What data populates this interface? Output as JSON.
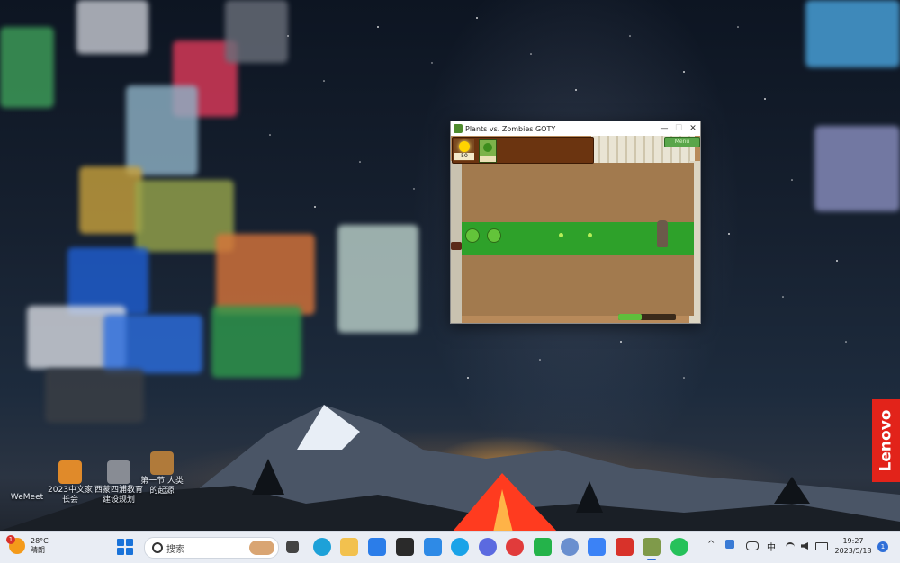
{
  "desktop": {
    "brand_logo": "Lenovo",
    "icons": [
      {
        "label": "WeMeet",
        "icon": "wemeet-app-icon"
      },
      {
        "label": "2023中文家长会",
        "icon": "document-icon"
      },
      {
        "label": "西蒙四浦教育 建设规划",
        "icon": "document-icon"
      },
      {
        "label": "第一节 人类的起源",
        "icon": "document-icon"
      }
    ]
  },
  "game_window": {
    "title": "Plants vs. Zombies GOTY",
    "controls": {
      "minimize": "—",
      "maximize": "☐",
      "close": "✕"
    },
    "sun_count": "50",
    "menu_label": "Menu",
    "level_progress": 0.4
  },
  "taskbar": {
    "weather": {
      "temperature": "28°C",
      "condition": "晴朗",
      "badge": "1"
    },
    "search_placeholder": "搜索",
    "apps": [
      "task-view-icon",
      "edge-browser-icon",
      "file-explorer-icon",
      "microsoft-store-icon",
      "sticky-notes-icon",
      "app-v-icon",
      "app-e-icon",
      "arc-browser-icon",
      "netease-music-icon",
      "wechat-chat-icon",
      "photos-icon",
      "cloud-drive-icon",
      "wps-office-icon",
      "pvz-game-icon",
      "wechat-icon"
    ],
    "tray": {
      "chevron": "^",
      "ime": "中"
    },
    "clock": {
      "time": "19:27",
      "date": "2023/5/18"
    },
    "notification_count": "1"
  },
  "colors": {
    "accent": "#2f6fd8",
    "lawn": "#2ea12a",
    "brand": "#e2231a"
  }
}
